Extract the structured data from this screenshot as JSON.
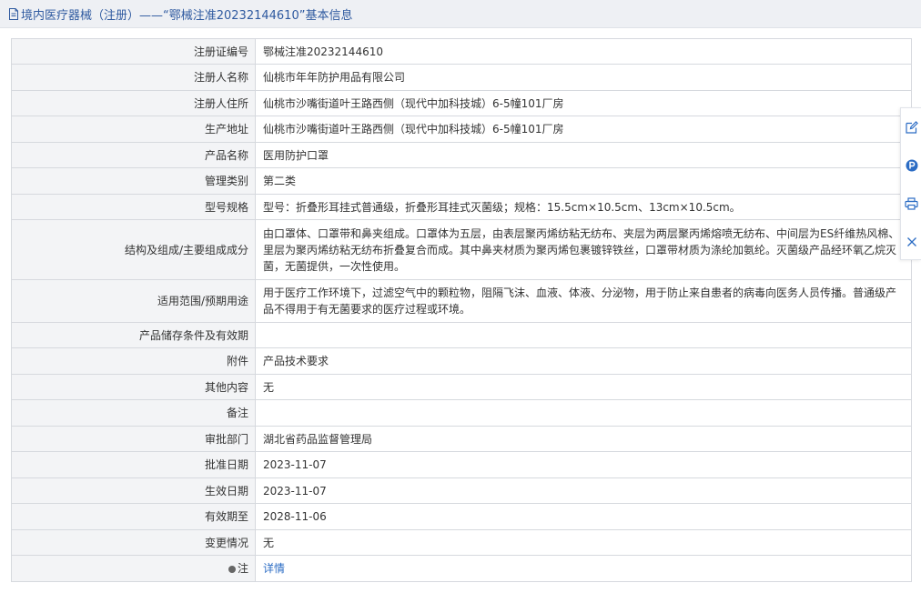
{
  "header": {
    "title": "境内医疗器械（注册）——“鄂械注准20232144610”基本信息",
    "icon": "document-icon"
  },
  "rows": [
    {
      "label": "注册证编号",
      "value": "鄂械注准20232144610"
    },
    {
      "label": "注册人名称",
      "value": "仙桃市年年防护用品有限公司"
    },
    {
      "label": "注册人住所",
      "value": "仙桃市沙嘴街道叶王路西侧（现代中加科技城）6-5幢101厂房"
    },
    {
      "label": "生产地址",
      "value": "仙桃市沙嘴街道叶王路西侧（现代中加科技城）6-5幢101厂房"
    },
    {
      "label": "产品名称",
      "value": "医用防护口罩"
    },
    {
      "label": "管理类别",
      "value": "第二类"
    },
    {
      "label": "型号规格",
      "value": "型号：折叠形耳挂式普通级，折叠形耳挂式灭菌级；规格：15.5cm×10.5cm、13cm×10.5cm。"
    },
    {
      "label": "结构及组成/主要组成成分",
      "value": "由口罩体、口罩带和鼻夹组成。口罩体为五层，由表层聚丙烯纺粘无纺布、夹层为两层聚丙烯熔喷无纺布、中间层为ES纤维热风棉、里层为聚丙烯纺粘无纺布折叠复合而成。其中鼻夹材质为聚丙烯包裹镀锌铁丝，口罩带材质为涤纶加氨纶。灭菌级产品经环氧乙烷灭菌，无菌提供，一次性使用。"
    },
    {
      "label": "适用范围/预期用途",
      "value": "用于医疗工作环境下，过滤空气中的颗粒物，阻隔飞沫、血液、体液、分泌物，用于防止来自患者的病毒向医务人员传播。普通级产品不得用于有无菌要求的医疗过程或环境。"
    },
    {
      "label": "产品储存条件及有效期",
      "value": ""
    },
    {
      "label": "附件",
      "value": "产品技术要求"
    },
    {
      "label": "其他内容",
      "value": "无"
    },
    {
      "label": "备注",
      "value": ""
    },
    {
      "label": "审批部门",
      "value": "湖北省药品监督管理局"
    },
    {
      "label": "批准日期",
      "value": "2023-11-07"
    },
    {
      "label": "生效日期",
      "value": "2023-11-07"
    },
    {
      "label": "有效期至",
      "value": "2028-11-06"
    },
    {
      "label": "变更情况",
      "value": "无"
    },
    {
      "label": "注",
      "value": "详情"
    }
  ],
  "side_tools": [
    {
      "name": "edit-icon"
    },
    {
      "name": "p-badge-icon"
    },
    {
      "name": "print-icon"
    },
    {
      "name": "close-icon"
    }
  ],
  "colors": {
    "header_bg": "#eef0f4",
    "title_text": "#2f5aa0",
    "label_bg": "#f3f4f6",
    "border": "#d6d9de",
    "link": "#2b6cc4",
    "tool_blue": "#2b6cc4"
  }
}
